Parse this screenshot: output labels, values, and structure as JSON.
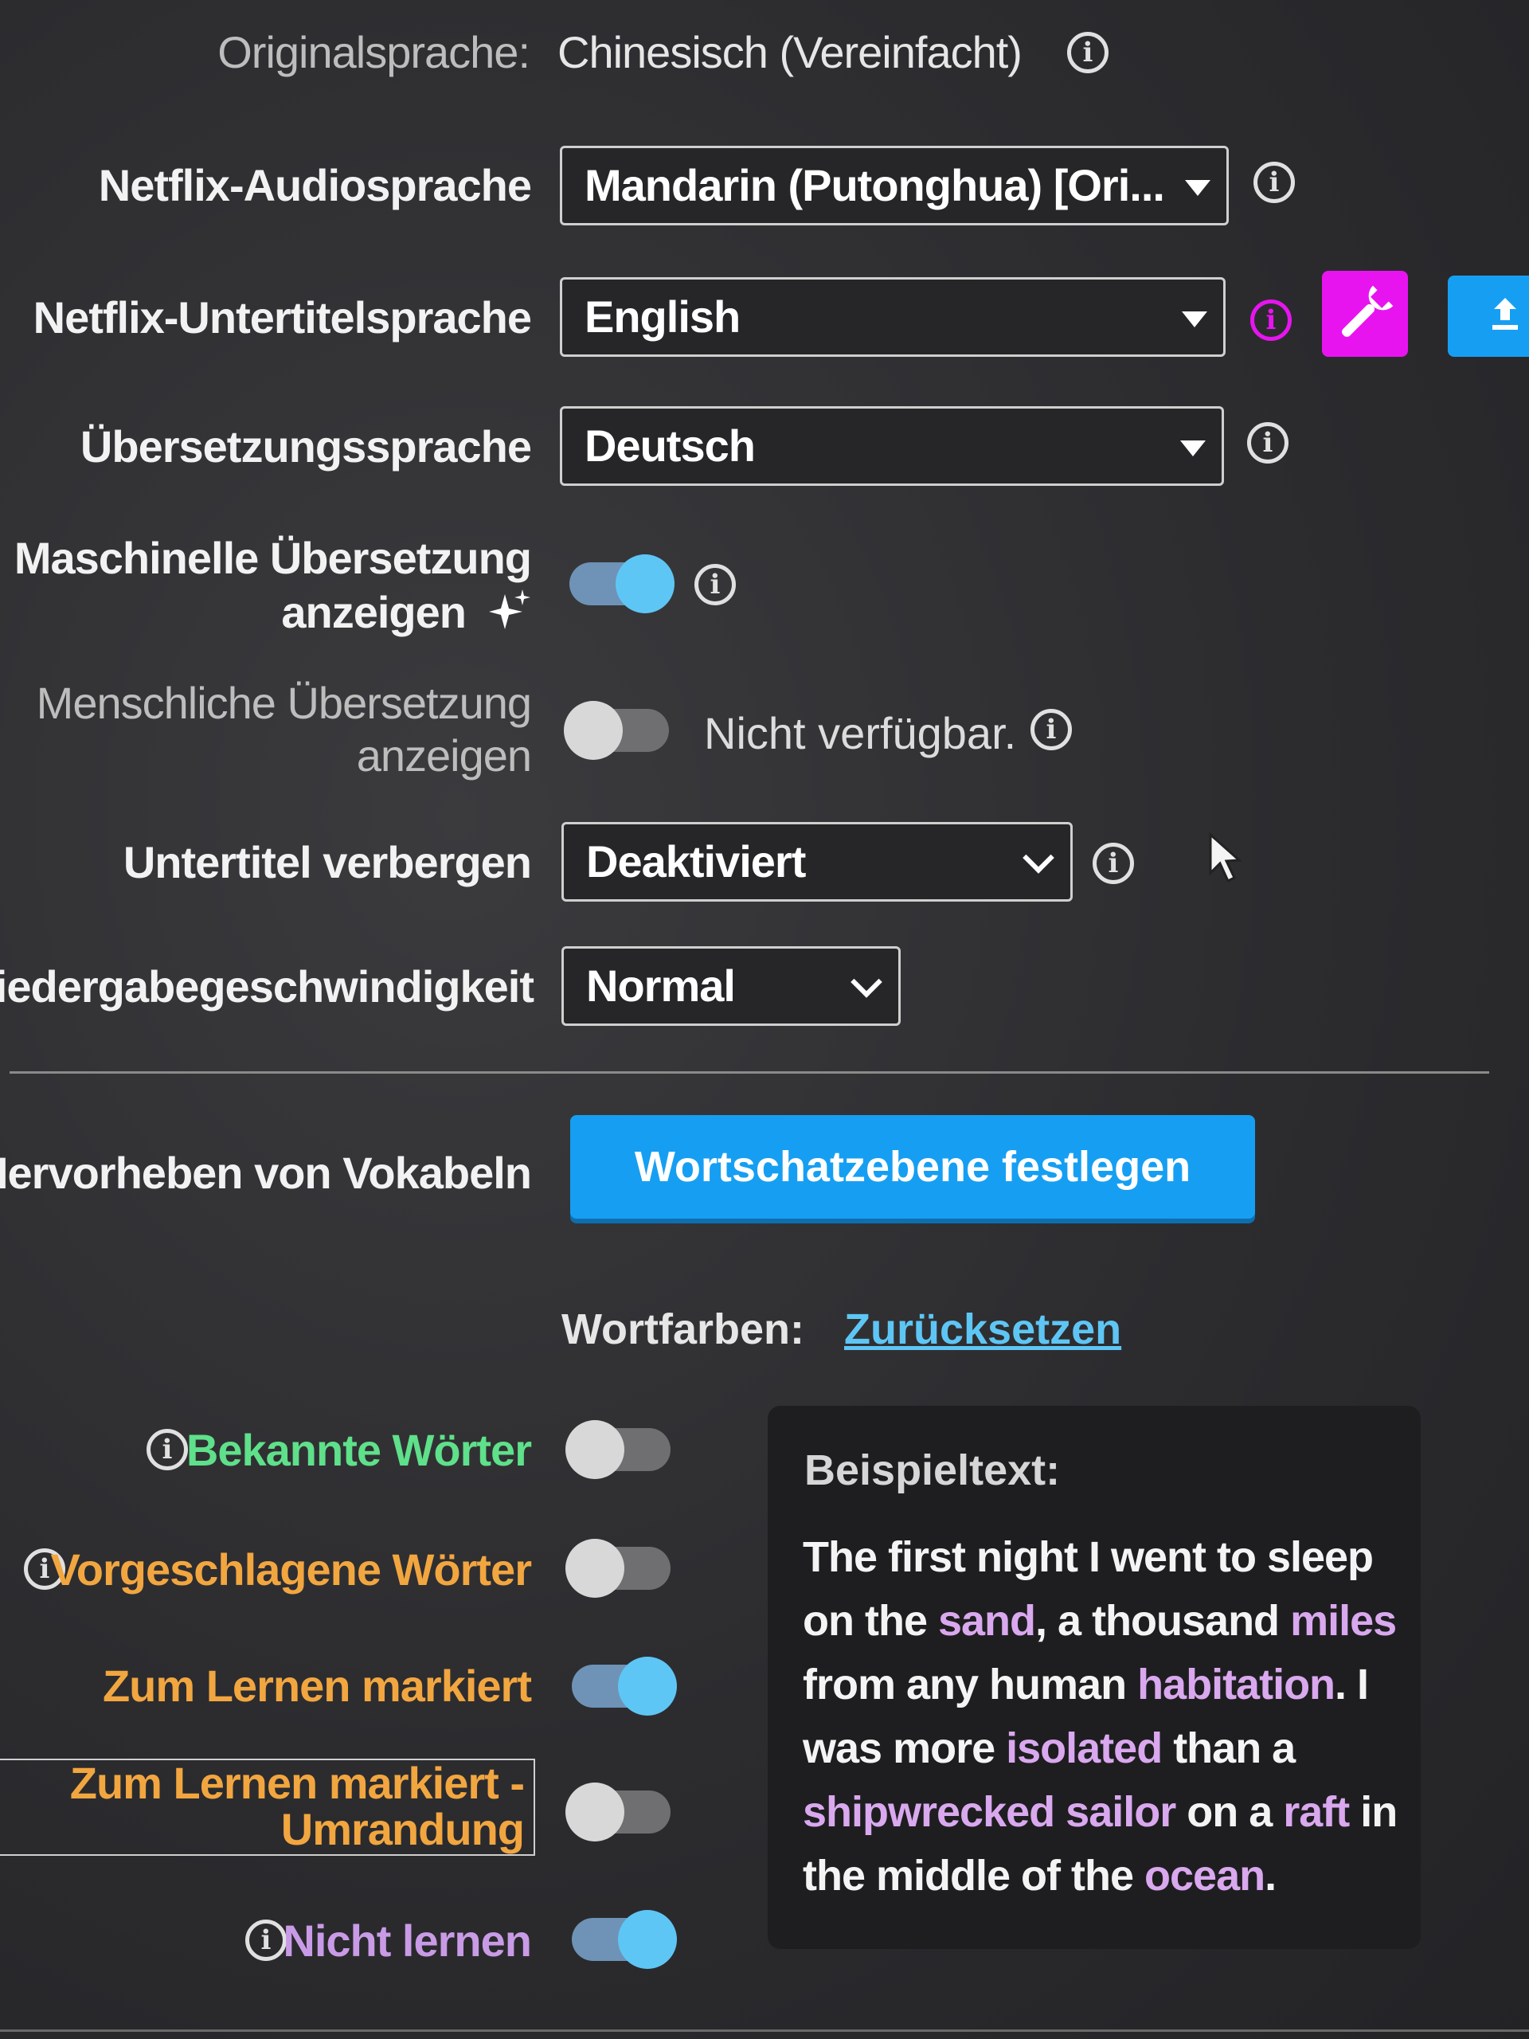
{
  "original_language": {
    "label": "Originalsprache:",
    "value": "Chinesisch (Vereinfacht)"
  },
  "audio_language": {
    "label": "Netflix-Audiosprache",
    "value": "Mandarin (Putonghua) [Ori..."
  },
  "subtitle_language": {
    "label": "Netflix-Untertitelsprache",
    "value": "English"
  },
  "translation_language": {
    "label": "Übersetzungssprache",
    "value": "Deutsch"
  },
  "machine_translation": {
    "label_line1": "Maschinelle Übersetzung",
    "label_line2": "anzeigen",
    "enabled": true
  },
  "human_translation": {
    "label_line1": "Menschliche Übersetzung",
    "label_line2": "anzeigen",
    "enabled": false,
    "status": "Nicht verfügbar."
  },
  "hide_subtitles": {
    "label": "Untertitel verbergen",
    "value": "Deaktiviert"
  },
  "playback_speed": {
    "label": "Wiedergabegeschwindigkeit",
    "value": "Normal"
  },
  "vocab_highlight": {
    "label": "Hervorheben von Vokabeln",
    "button": "Wortschatzebene festlegen"
  },
  "word_colors": {
    "label": "Wortfarben:",
    "reset": "Zurücksetzen"
  },
  "word_toggles": {
    "known": {
      "label": "Bekannte Wörter",
      "enabled": false,
      "color": "#5fe08a"
    },
    "suggested": {
      "label": "Vorgeschlagene Wörter",
      "enabled": false,
      "color": "#f2a640"
    },
    "marked": {
      "label": "Zum Lernen markiert",
      "enabled": true,
      "color": "#f2a640"
    },
    "marked_outline": {
      "label_line1": "Zum Lernen markiert -",
      "label_line2": "Umrandung",
      "enabled": false,
      "color": "#f2a640"
    },
    "not_learn": {
      "label": "Nicht lernen",
      "enabled": true,
      "color": "#c99be6"
    }
  },
  "sample": {
    "title": "Beispieltext:",
    "line1": "The first night I went to sleep",
    "line2_a": "on the ",
    "line2_b": "sand",
    "line2_c": ", a thousand ",
    "line2_d": "miles",
    "line3_a": "from any human ",
    "line3_b": "habitation",
    "line3_c": ". I",
    "line4_a": "was more ",
    "line4_b": "isolated",
    "line4_c": " than a",
    "line5_a": "shipwrecked",
    "line5_b": " ",
    "line5_c": "sailor",
    "line5_d": " on a ",
    "line5_e": "raft",
    "line5_f": " in",
    "line6_a": "the middle of the ",
    "line6_b": "ocean",
    "line6_c": "."
  },
  "colors": {
    "accent_blue": "#169ff2",
    "magenta": "#e814f0",
    "highlight_purple": "#d9a8ee"
  },
  "icons": [
    "info-icon",
    "wrench-icon",
    "upload-icon",
    "sparkle-icon",
    "mouse-cursor-icon"
  ]
}
